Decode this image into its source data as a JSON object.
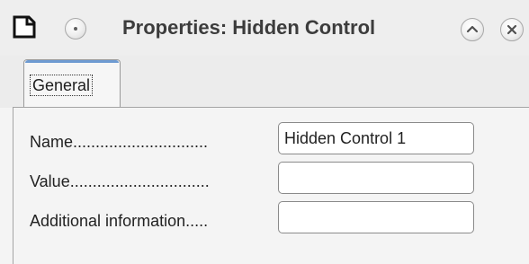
{
  "window": {
    "title": "Properties: Hidden Control"
  },
  "tabs": [
    {
      "label": "General",
      "active": true
    }
  ],
  "form": {
    "name_label": "Name..............................",
    "name_value": "Hidden Control 1",
    "value_label": "Value...............................",
    "value_value": "",
    "additional_label": "Additional information.....",
    "additional_value": ""
  },
  "icons": {
    "app": "document-icon",
    "window_menu": "window-menu-icon",
    "shade": "chevron-up-icon",
    "close": "close-icon"
  },
  "colors": {
    "tab_accent": "#6e9bd2",
    "title_text": "#3c3c3c"
  }
}
